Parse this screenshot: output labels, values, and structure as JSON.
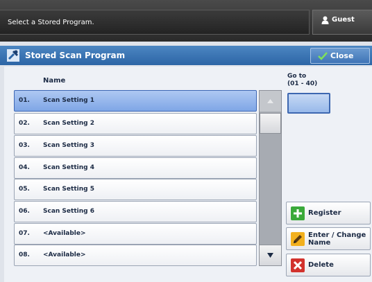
{
  "status": {
    "message": "Select a Stored Program.",
    "user": "Guest"
  },
  "titlebar": {
    "title": "Stored Scan Program",
    "close_label": "Close"
  },
  "list": {
    "column_header": "Name",
    "rows": [
      {
        "num": "01.",
        "name": "Scan Setting 1",
        "selected": true
      },
      {
        "num": "02.",
        "name": "Scan Setting 2"
      },
      {
        "num": "03.",
        "name": "Scan Setting 3"
      },
      {
        "num": "04.",
        "name": "Scan Setting 4"
      },
      {
        "num": "05.",
        "name": "Scan Setting 5"
      },
      {
        "num": "06.",
        "name": "Scan Setting 6"
      },
      {
        "num": "07.",
        "name": "<Available>"
      },
      {
        "num": "08.",
        "name": "<Available>"
      }
    ]
  },
  "goto": {
    "label": "Go to",
    "range": "(01 - 40)"
  },
  "actions": {
    "register": "Register",
    "enter_change_line1": "Enter / Change",
    "enter_change_line2": "Name",
    "delete": "Delete"
  },
  "colors": {
    "accent": "#2c65a6",
    "selected_row": "#7fa6e6",
    "register_green": "#3aa93a",
    "delete_red": "#d2322d",
    "edit_yellow": "#f2b01e"
  }
}
